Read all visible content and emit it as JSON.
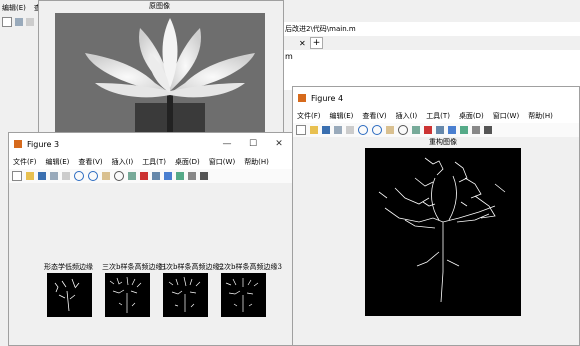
{
  "bg_window": {
    "menu": [
      "编辑(E)",
      "查"
    ],
    "tab_path": "后改进2\\代码\\main.m",
    "editor_tab": "m",
    "plus": "+"
  },
  "fig_top": {
    "axes_title": "原图像"
  },
  "figure3": {
    "title": "Figure 3",
    "menu": [
      "文件(F)",
      "编辑(E)",
      "查看(V)",
      "插入(I)",
      "工具(T)",
      "桌面(D)",
      "窗口(W)",
      "帮助(H)"
    ],
    "axes_titles": [
      "形态学低频边缘",
      "三次b样条高频边缘1",
      "三次b样条高频边缘2",
      "三次b样条高频边缘3"
    ]
  },
  "figure4": {
    "title": "Figure 4",
    "menu": [
      "文件(F)",
      "编辑(E)",
      "查看(V)",
      "插入(I)",
      "工具(T)",
      "桌面(D)",
      "窗口(W)",
      "帮助(H)"
    ],
    "axes_title": "重构图像"
  },
  "controls": {
    "minimize": "—",
    "maximize": "☐",
    "close": "✕"
  },
  "colors": {
    "accent": "#0066cc",
    "figure_bg": "#f0f0f0",
    "image_bg": "#000000"
  }
}
